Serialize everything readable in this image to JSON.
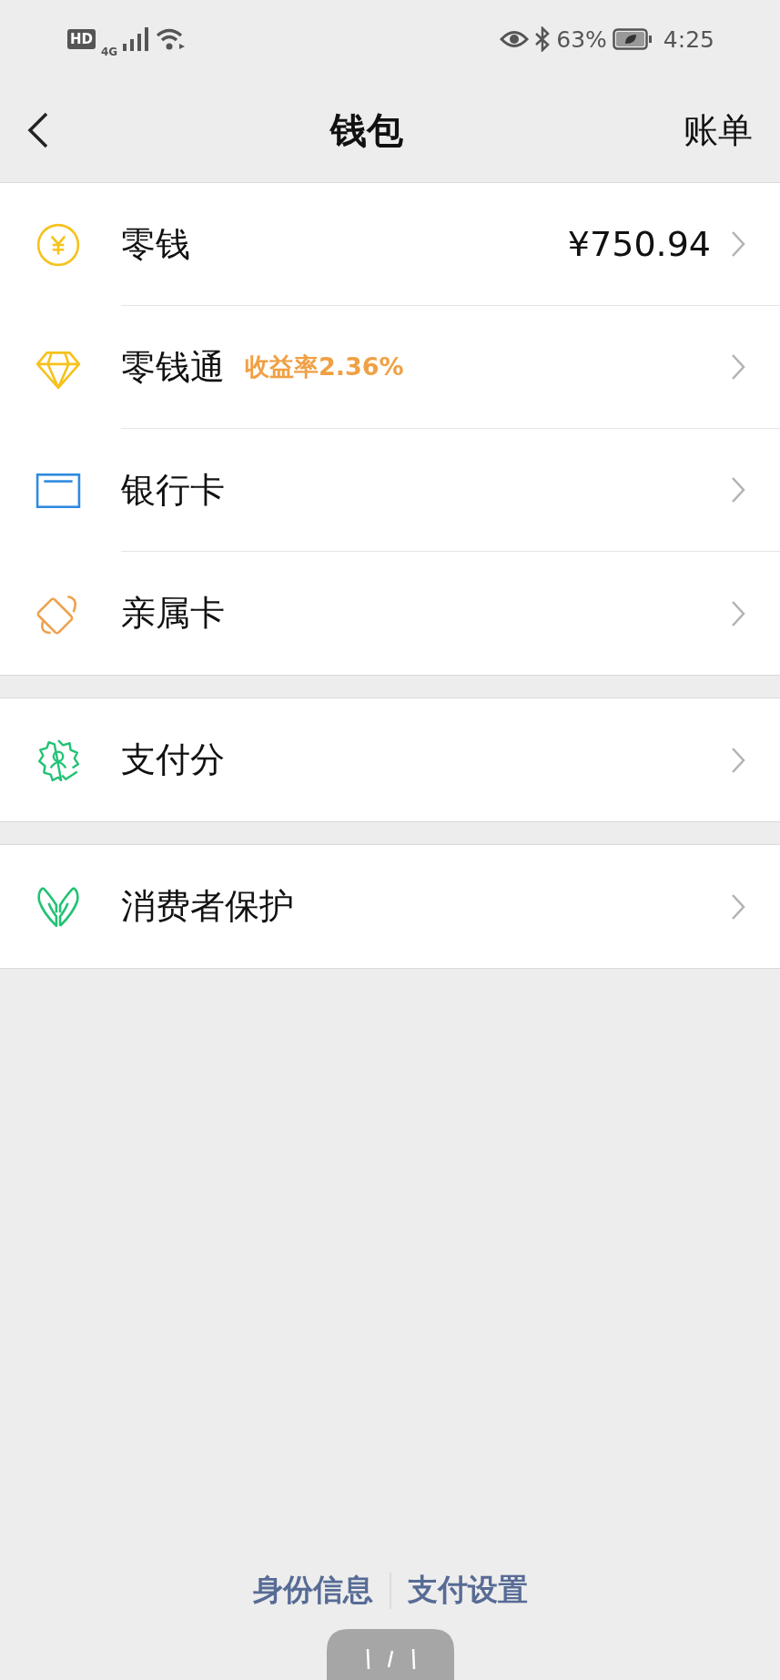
{
  "status_bar": {
    "badge": "HD",
    "network": "4G",
    "battery_percent": "63%",
    "time": "4:25"
  },
  "nav": {
    "title": "钱包",
    "action": "账单"
  },
  "groups": [
    {
      "items": [
        {
          "label": "零钱",
          "value": "¥750.94"
        },
        {
          "label": "零钱通",
          "tag": "收益率2.36%"
        },
        {
          "label": "银行卡"
        },
        {
          "label": "亲属卡"
        }
      ]
    },
    {
      "items": [
        {
          "label": "支付分"
        }
      ]
    },
    {
      "items": [
        {
          "label": "消费者保护"
        }
      ]
    }
  ],
  "footer_links": [
    "身份信息",
    "支付设置"
  ]
}
